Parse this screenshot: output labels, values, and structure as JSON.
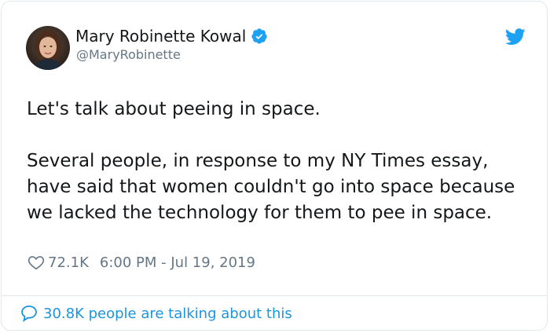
{
  "author": {
    "name": "Mary Robinette Kowal",
    "handle": "@MaryRobinette",
    "verified": true
  },
  "tweet": {
    "line1": "Let's talk about peeing in space.",
    "line2": "Several people, in response to my NY Times essay, have said that women couldn't go into space because we lacked the technology for them to pee in space."
  },
  "meta": {
    "likes": "72.1K",
    "timestamp": "6:00 PM - Jul 19, 2019"
  },
  "footer": {
    "talking": "30.8K people are talking about this"
  },
  "colors": {
    "twitter_blue": "#1da1f2",
    "link_blue": "#1b95e0",
    "text": "#14171a",
    "secondary": "#657786"
  },
  "icons": {
    "verified": "verified-badge-icon",
    "logo": "twitter-bird-icon",
    "like": "heart-icon",
    "reply": "speech-bubble-icon"
  }
}
